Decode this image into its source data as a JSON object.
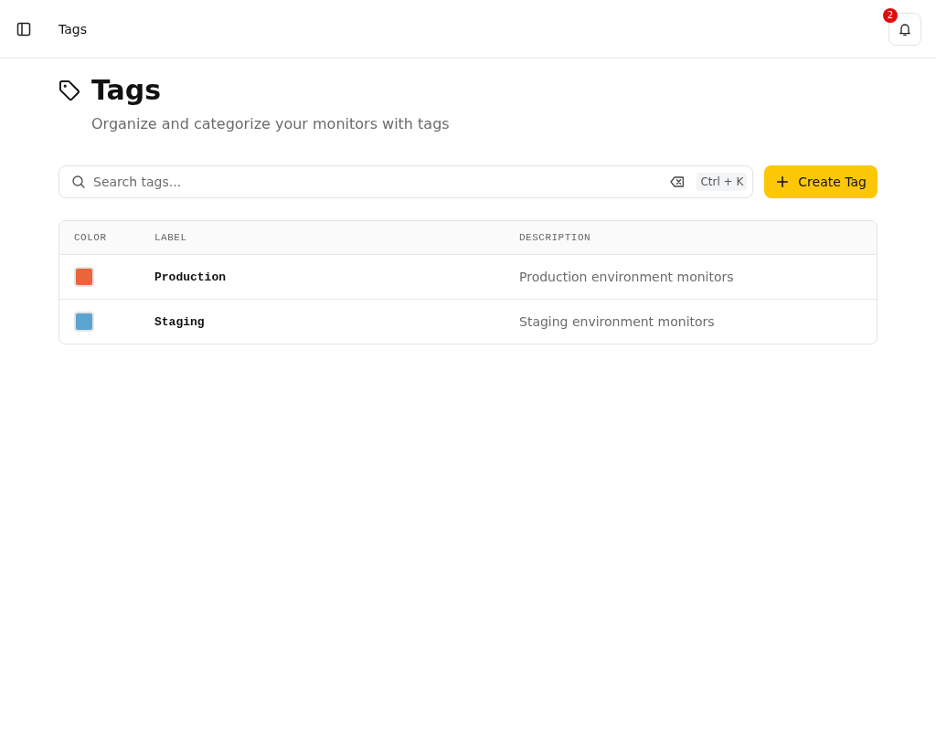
{
  "header": {
    "title": "Tags",
    "notification_count": "2"
  },
  "page": {
    "title": "Tags",
    "subtitle": "Organize and categorize your monitors with tags"
  },
  "search": {
    "placeholder": "Search tags...",
    "shortcut": "Ctrl + K"
  },
  "create_button": {
    "label": "Create Tag"
  },
  "table": {
    "columns": [
      "COLOR",
      "LABEL",
      "DESCRIPTION"
    ],
    "rows": [
      {
        "color": "#e8663a",
        "label": "Production",
        "description": "Production environment monitors"
      },
      {
        "color": "#5ba4cf",
        "label": "Staging",
        "description": "Staging environment monitors"
      }
    ]
  }
}
